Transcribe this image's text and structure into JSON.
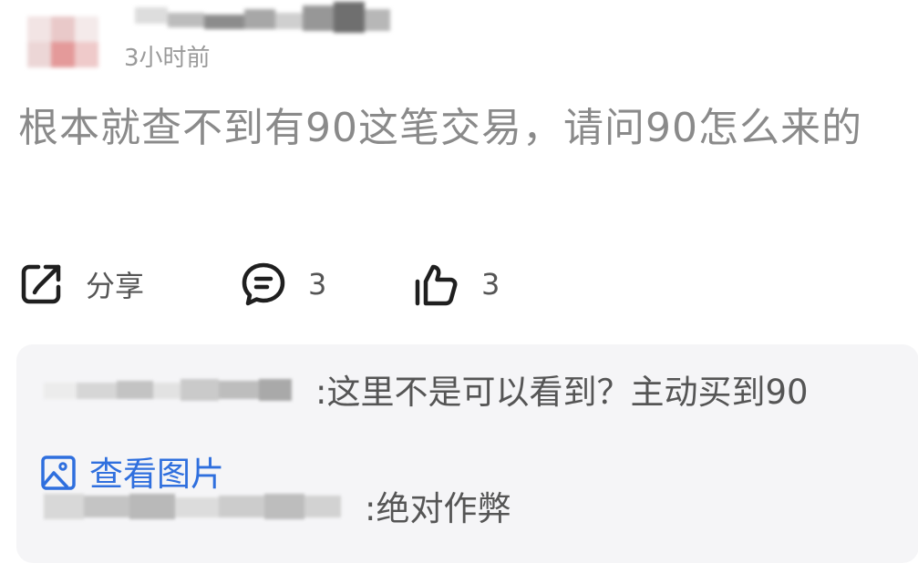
{
  "header": {
    "timestamp": "3小时前"
  },
  "comment": {
    "text": "根本就查不到有90这笔交易，请问90怎么来的"
  },
  "actions": {
    "share_label": "分享",
    "comment_count": "3",
    "like_count": "3"
  },
  "replies": [
    {
      "text": ":这里不是可以看到？主动买到90"
    },
    {
      "text": ":绝对作弊"
    }
  ],
  "view_image_label": "查看图片",
  "colors": {
    "link_blue": "#2f6fde",
    "timestamp_gray": "#9a9a9a",
    "comment_gray": "#8a8a8a",
    "reply_bg": "#f5f5f7"
  },
  "icons": [
    "share-icon",
    "comment-bubble-icon",
    "thumbs-up-icon",
    "image-icon"
  ]
}
